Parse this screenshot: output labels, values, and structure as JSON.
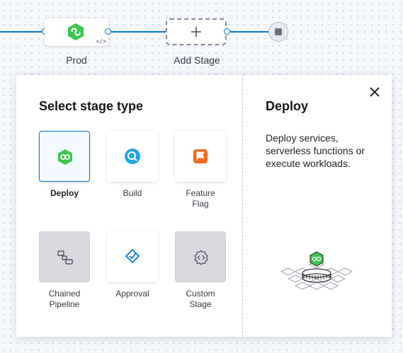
{
  "pipeline": {
    "stage_label": "Prod",
    "add_stage_label": "Add Stage"
  },
  "dialog": {
    "title": "Select stage type",
    "stage_types": [
      {
        "label": "Deploy",
        "icon": "deploy-icon",
        "state": "selected"
      },
      {
        "label": "Build",
        "icon": "build-icon",
        "state": "enabled"
      },
      {
        "label": "Feature\nFlag",
        "icon": "feature-flag-icon",
        "state": "enabled"
      },
      {
        "label": "Chained\nPipeline",
        "icon": "chained-pipeline-icon",
        "state": "disabled"
      },
      {
        "label": "Approval",
        "icon": "approval-icon",
        "state": "enabled"
      },
      {
        "label": "Custom\nStage",
        "icon": "custom-stage-icon",
        "state": "disabled"
      }
    ],
    "detail": {
      "title": "Deploy",
      "description": "Deploy services, serverless functions or execute workloads."
    }
  },
  "colors": {
    "accent": "#0278d5",
    "deploy_green": "#3dc54e",
    "feature_flag_orange": "#ef6c22"
  }
}
